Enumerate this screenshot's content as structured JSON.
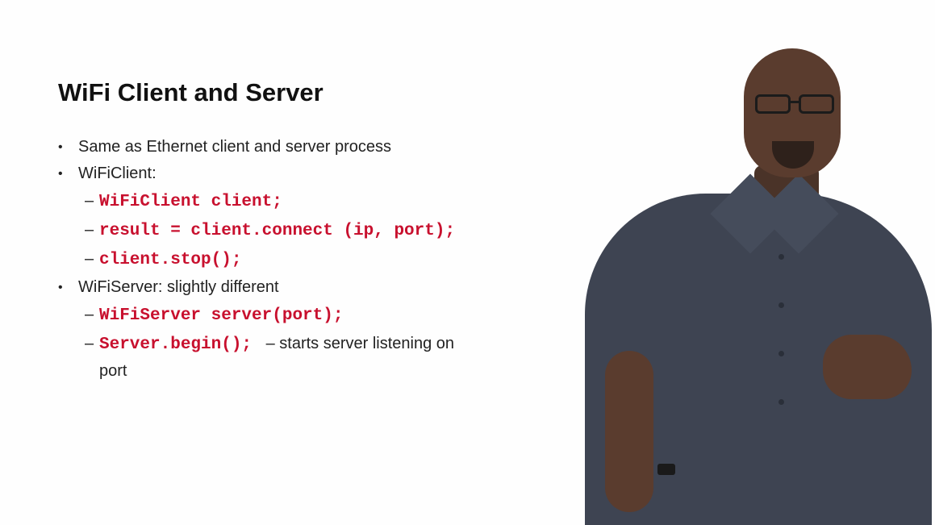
{
  "slide": {
    "title": "WiFi Client and Server",
    "bullets": [
      {
        "text": "Same as Ethernet client and server process"
      },
      {
        "text": "WiFiClient:"
      },
      {
        "text": "WiFiServer: slightly different"
      }
    ],
    "client_code": [
      "WiFiClient client;",
      "result = client.connect (ip, port);",
      "client.stop();"
    ],
    "server_code": [
      "WiFiServer server(port);",
      "Server.begin();"
    ],
    "server_begin_note_line1": "– starts server listening on",
    "server_begin_note_line2": "port",
    "dash": "–"
  },
  "colors": {
    "code": "#c8102e",
    "background": "#fefefe"
  },
  "presenter": {
    "icon": "presenter-image"
  }
}
